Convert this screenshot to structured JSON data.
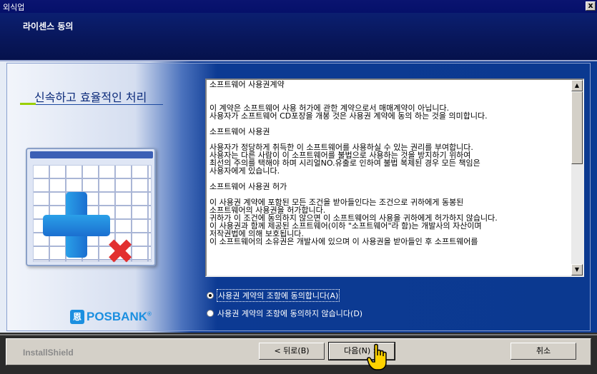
{
  "window": {
    "title": "외식업",
    "close_label": "x"
  },
  "header": {
    "heading": "라이센스 동의"
  },
  "sidebar": {
    "slogan": "신속하고 효율적인 처리",
    "logo_mark": "恩",
    "logo_text": "POSBANK",
    "logo_suffix": "®"
  },
  "license": {
    "text": "소프트웨어 사용권계약\n\n\n이 계약은 소프트웨어 사용 허가에 관한 계약으로서 매매계약이 아닙니다.\n사용자가 소프트웨어 CD포장을 개봉 것은 사용권 계약에 동의 하는 것을 의미합니다.\n\n소프트웨어 사용권\n\n사용자가 정당하게 취득한 이 소프트웨어를 사용하실 수 있는 권리를 부여합니다.\n사용자는 다른 사람이 이 소프트웨어를 불법으로 사용하는 것을 방지하기 위하여\n최선의 주의를 택해야 하며 시리얼NO.유출로 인하여 불법 복제된 경우 모든 책임은\n사용자에게 있습니다.\n\n소프트웨어 사용권 허가\n\n이 사용권 계약에 포함된 모든 조건을 받아들인다는 조건으로 귀하에게 동봉된\n소프트웨어의 사용권을 허가합니다.\n귀하가 이 조건에 동의하지 않으면 이 소프트웨어의 사용을 귀하에게 허가하지 않습니다.\n이 사용권과 함께 제공된 소프트웨어(이하 \"소프트웨어\"라 함)는 개발사의 자산이며\n저작권법에 의해 보호됩니다.\n이 소프트웨어의 소유권은 개발사에 있으며 이 사용권을 받아들인 후 소프트웨어를"
  },
  "options": {
    "accept_label": "사용권 계약의 조항에 동의합니다(A)",
    "decline_label": "사용권 계약의 조항에 동의하지 않습니다(D)",
    "selected": "accept"
  },
  "footer": {
    "brand": "InstallShield",
    "back_label": "< 뒤로(B)",
    "next_label": "다음(N) >",
    "cancel_label": "취소"
  },
  "colors": {
    "header_bg": "#081659",
    "panel_blue": "#0c3a93",
    "logo_blue": "#1b8fe0"
  }
}
